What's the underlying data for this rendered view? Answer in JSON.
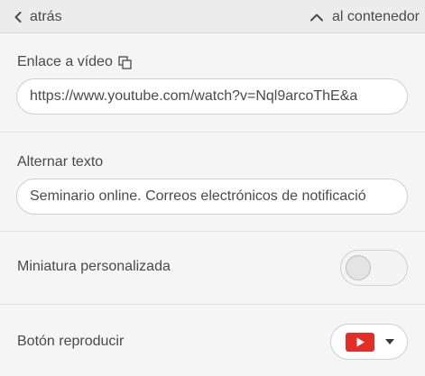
{
  "nav": {
    "back_label": "atrás",
    "container_label": "al contenedor"
  },
  "video_link": {
    "label": "Enlace a vídeo",
    "value": "https://www.youtube.com/watch?v=Nql9arcoThE&a"
  },
  "alt_text": {
    "label": "Alternar texto",
    "value": "Seminario online. Correos electrónicos de notificació"
  },
  "custom_thumbnail": {
    "label": "Miniatura personalizada",
    "enabled": false
  },
  "play_button": {
    "label": "Botón reproducir",
    "selected": "youtube-play-icon",
    "icon_color": "#e52d27"
  }
}
